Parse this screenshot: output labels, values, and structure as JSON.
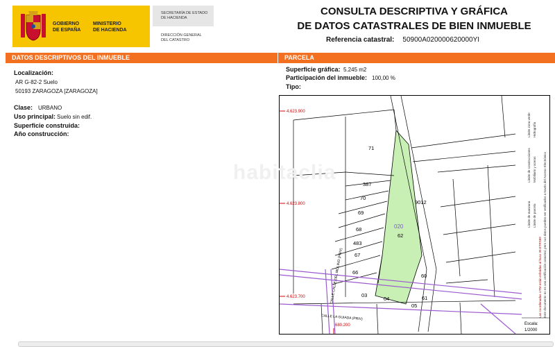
{
  "header": {
    "gov_left": [
      "GOBIERNO",
      "DE ESPAÑA"
    ],
    "gov_right": [
      "MINISTERIO",
      "DE HACIENDA"
    ],
    "secretaria": [
      "SECRETARÍA DE ESTADO",
      "DE HACIENDA"
    ],
    "direccion": [
      "DIRECCIÓN GENERAL",
      "DEL CATASTRO"
    ],
    "title_line1": "CONSULTA DESCRIPTIVA Y GRÁFICA",
    "title_line2": "DE DATOS CATASTRALES DE BIEN INMUEBLE",
    "ref_label": "Referencia catastral:",
    "ref_value": "50900A020000620000YI"
  },
  "left": {
    "section_title": "DATOS DESCRIPTIVOS DEL INMUEBLE",
    "localizacion_label": "Localización:",
    "localizacion_line1": "AR G-82-2  Suelo",
    "localizacion_line2": "50193 ZARAGOZA [ZARAGOZA]",
    "clase_label": "Clase:",
    "clase_value": "URBANO",
    "uso_label": "Uso principal:",
    "uso_value": "Suelo sin edif.",
    "superficie_label": "Superficie construida:",
    "anio_label": "Año construcción:"
  },
  "right": {
    "section_title": "PARCELA",
    "sup_grafica_label": "Superficie gráfica:",
    "sup_grafica_value": "5.245 m2",
    "participacion_label": "Participación del inmueble:",
    "participacion_value": "100,00 %",
    "tipo_label": "Tipo:"
  },
  "plan": {
    "coord_labels": [
      "4.623.900",
      "4.623.800",
      "4.623.700",
      "680.200"
    ],
    "parcel_numbers": [
      "71",
      "387",
      "70",
      "69",
      "68",
      "483",
      "67",
      "66",
      "9012",
      "62",
      "60",
      "61",
      "05",
      "04",
      "03"
    ],
    "highlight_number": "020",
    "street_labels": [
      "CALLE CALLE DEL MOLINO (PRIV)",
      "CALLE LA GUIADA (PRIV)"
    ],
    "scale_label": "Escala:",
    "scale_value": "1/2000",
    "highlight_fill": "#c8f0b4"
  },
  "legend": {
    "items": [
      "Límite de manzana",
      "Límite de parcela",
      "Límite de construcciones",
      "Mobiliario y aceras",
      "Límite zona verde",
      "Hidrografía"
    ],
    "note": "Este documento no es una certificación catastral, pero sus datos pueden ser verificados a través del Acceso Electrónico",
    "coords_note": "Las coordenadas UTM están referidas al huso 30 ETRS89"
  },
  "watermark": "habitaclia",
  "colors": {
    "accent": "#f37021",
    "logo_bg": "#f7c400",
    "parcel_green": "#c8f0b4",
    "boundary": "#9b59d0"
  }
}
